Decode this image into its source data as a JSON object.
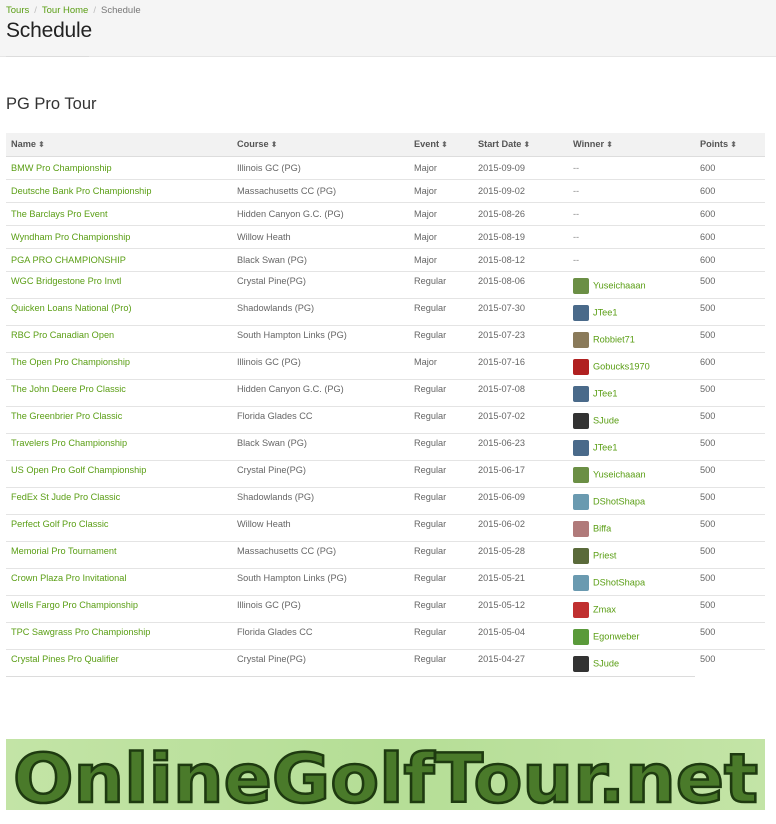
{
  "breadcrumb": {
    "items": [
      {
        "label": "Tours"
      },
      {
        "label": "Tour Home"
      }
    ],
    "current": "Schedule",
    "separator": "/"
  },
  "page": {
    "title": "Schedule"
  },
  "tour": {
    "title": "PG Pro Tour"
  },
  "table": {
    "sort_icon": "sort-icon",
    "columns": [
      "Name",
      "Course",
      "Event",
      "Start Date",
      "Winner",
      "Points"
    ],
    "rows": [
      {
        "name": "BMW Pro Championship",
        "course": "Illinois GC (PG)",
        "event": "Major",
        "date": "2015-09-09",
        "winner": "--",
        "avatar": "",
        "points": "600"
      },
      {
        "name": "Deutsche Bank Pro Championship",
        "course": "Massachusetts CC (PG)",
        "event": "Major",
        "date": "2015-09-02",
        "winner": "--",
        "avatar": "",
        "points": "600"
      },
      {
        "name": "The Barclays Pro Event",
        "course": "Hidden Canyon G.C. (PG)",
        "event": "Major",
        "date": "2015-08-26",
        "winner": "--",
        "avatar": "",
        "points": "600"
      },
      {
        "name": "Wyndham Pro Championship",
        "course": "Willow Heath",
        "event": "Major",
        "date": "2015-08-19",
        "winner": "--",
        "avatar": "",
        "points": "600"
      },
      {
        "name": "PGA PRO CHAMPIONSHIP",
        "course": "Black Swan (PG)",
        "event": "Major",
        "date": "2015-08-12",
        "winner": "--",
        "avatar": "",
        "points": "600"
      },
      {
        "name": "WGC Bridgestone Pro Invtl",
        "course": "Crystal Pine(PG)",
        "event": "Regular",
        "date": "2015-08-06",
        "winner": "Yuseichaaan",
        "avatar": "#6b8f45",
        "points": "500"
      },
      {
        "name": "Quicken Loans National (Pro)",
        "course": "Shadowlands (PG)",
        "event": "Regular",
        "date": "2015-07-30",
        "winner": "JTee1",
        "avatar": "#4a6a8a",
        "points": "500"
      },
      {
        "name": "RBC Pro Canadian Open",
        "course": "South Hampton Links (PG)",
        "event": "Regular",
        "date": "2015-07-23",
        "winner": "Robbiet71",
        "avatar": "#8a7a5a",
        "points": "500"
      },
      {
        "name": "The Open Pro Championship",
        "course": "Illinois GC (PG)",
        "event": "Major",
        "date": "2015-07-16",
        "winner": "Gobucks1970",
        "avatar": "#b02020",
        "points": "600"
      },
      {
        "name": "The John Deere Pro Classic",
        "course": "Hidden Canyon G.C. (PG)",
        "event": "Regular",
        "date": "2015-07-08",
        "winner": "JTee1",
        "avatar": "#4a6a8a",
        "points": "500"
      },
      {
        "name": "The Greenbrier Pro Classic",
        "course": "Florida Glades CC",
        "event": "Regular",
        "date": "2015-07-02",
        "winner": "SJude",
        "avatar": "#333333",
        "points": "500"
      },
      {
        "name": "Travelers Pro Championship",
        "course": "Black Swan (PG)",
        "event": "Regular",
        "date": "2015-06-23",
        "winner": "JTee1",
        "avatar": "#4a6a8a",
        "points": "500"
      },
      {
        "name": "US Open Pro Golf Championship",
        "course": "Crystal Pine(PG)",
        "event": "Regular",
        "date": "2015-06-17",
        "winner": "Yuseichaaan",
        "avatar": "#6b8f45",
        "points": "500"
      },
      {
        "name": "FedEx St Jude Pro Classic",
        "course": "Shadowlands (PG)",
        "event": "Regular",
        "date": "2015-06-09",
        "winner": "DShotShapa",
        "avatar": "#6a9ab0",
        "points": "500"
      },
      {
        "name": "Perfect Golf Pro Classic",
        "course": "Willow Heath",
        "event": "Regular",
        "date": "2015-06-02",
        "winner": "Biffa",
        "avatar": "#b07a7a",
        "points": "500"
      },
      {
        "name": "Memorial Pro Tournament",
        "course": "Massachusetts CC (PG)",
        "event": "Regular",
        "date": "2015-05-28",
        "winner": "Priest",
        "avatar": "#5a6a3a",
        "points": "500"
      },
      {
        "name": "Crown Plaza Pro Invitational",
        "course": "South Hampton Links (PG)",
        "event": "Regular",
        "date": "2015-05-21",
        "winner": "DShotShapa",
        "avatar": "#6a9ab0",
        "points": "500"
      },
      {
        "name": "Wells Fargo Pro Championship",
        "course": "Illinois GC (PG)",
        "event": "Regular",
        "date": "2015-05-12",
        "winner": "Zmax",
        "avatar": "#c03030",
        "points": "500"
      },
      {
        "name": "TPC Sawgrass Pro Championship",
        "course": "Florida Glades CC",
        "event": "Regular",
        "date": "2015-05-04",
        "winner": "Egonweber",
        "avatar": "#5a9a3a",
        "points": "500"
      },
      {
        "name": "Crystal Pines Pro Qualifier",
        "course": "Crystal Pine(PG)",
        "event": "Regular",
        "date": "2015-04-27",
        "winner": "SJude",
        "avatar": "#333333",
        "points": "500"
      }
    ]
  },
  "banner": {
    "text": "OnlineGolfTour.net",
    "bg_color": "#a8d58c",
    "text_color": "#2e5a1c"
  },
  "colors": {
    "link": "#5a9e14",
    "header_bg": "#f5f5f5"
  }
}
